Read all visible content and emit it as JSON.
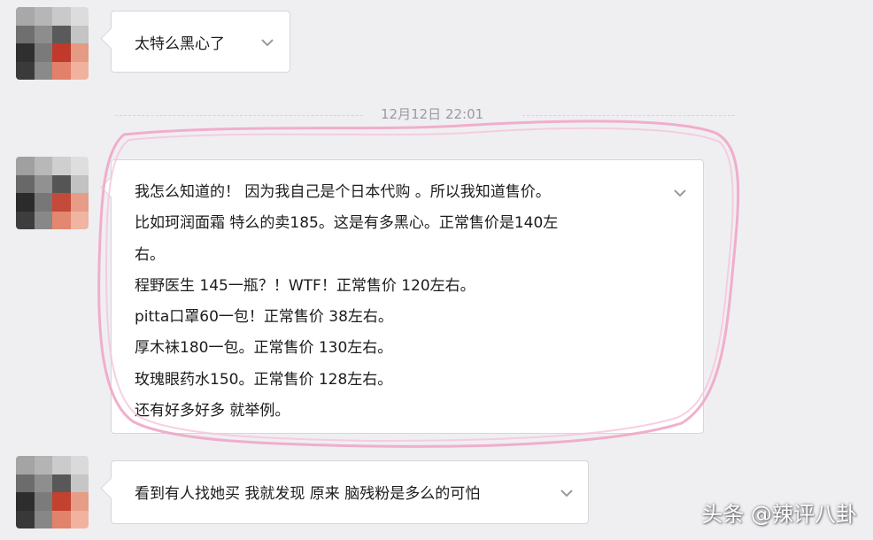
{
  "chat": {
    "messages": [
      {
        "text": "太特么黑心了"
      },
      {
        "lines": [
          "我怎么知道的！ 因为我自己是个日本代购 。所以我知道售价。",
          "比如珂润面霜 特么的卖185。这是有多黑心。正常售价是140左",
          "右。",
          "程野医生 145一瓶？！WTF！正常售价 120左右。",
          "pitta口罩60一包！正常售价 38左右。",
          "厚木袜180一包。正常售价 130左右。",
          "玫瑰眼药水150。正常售价 128左右。",
          "还有好多好多 就举例。"
        ]
      },
      {
        "text": "看到有人找她买 我就发现 原来 脑残粉是多么的可怕"
      }
    ],
    "timestamp": "12月12日 22:01"
  },
  "watermark": "头条 @辣评八卦",
  "colors": {
    "background": "#efeff2",
    "bubble": "#ffffff",
    "border": "#d6d6da",
    "highlight": "#f0a6c8",
    "timestamp": "#9a9aa0"
  },
  "icons": {
    "expand": "chevron-down-icon"
  }
}
